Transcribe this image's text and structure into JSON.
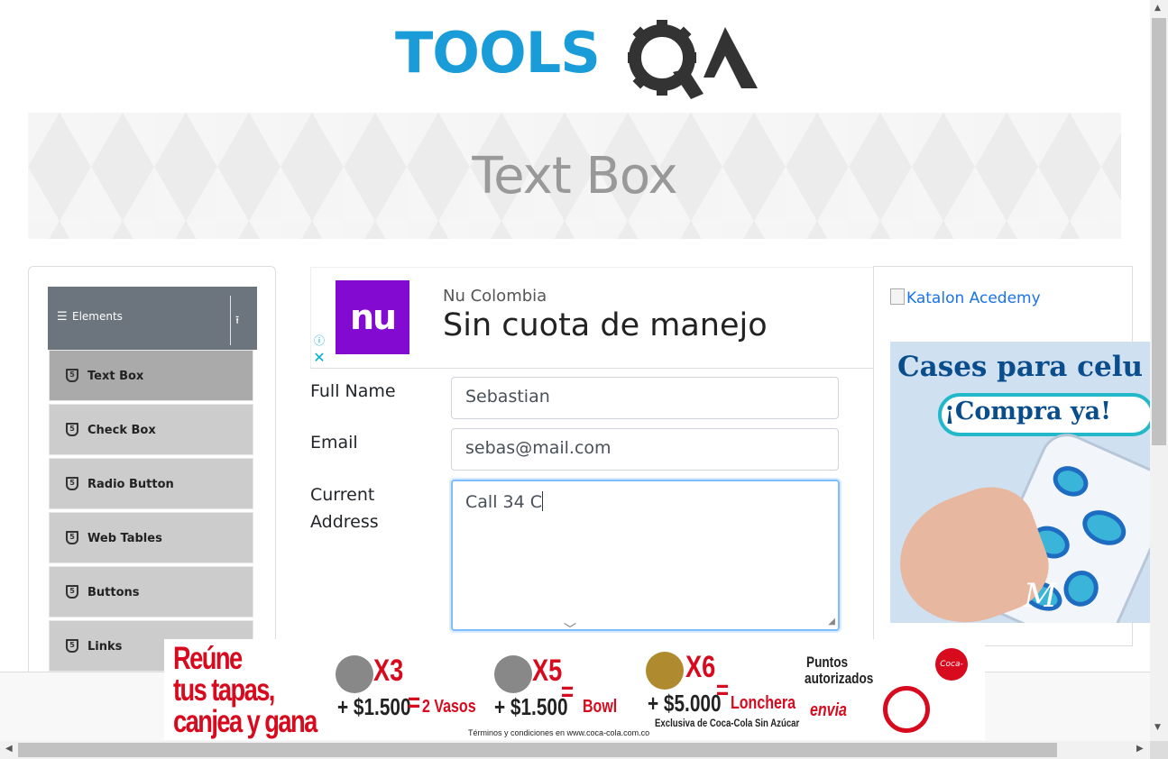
{
  "header": {
    "logo_text": "TOOLS",
    "logo_suffix": "QA"
  },
  "banner": {
    "title": "Text Box"
  },
  "sidebar": {
    "group_title": "Elements",
    "items": [
      {
        "label": "Text Box",
        "active": true
      },
      {
        "label": "Check Box"
      },
      {
        "label": "Radio Button"
      },
      {
        "label": "Web Tables"
      },
      {
        "label": "Buttons"
      },
      {
        "label": "Links"
      }
    ]
  },
  "ad_top": {
    "logo": "nu",
    "brand": "Nu Colombia",
    "headline": "Sin cuota de manejo"
  },
  "form": {
    "full_name_label": "Full Name",
    "full_name_value": "Sebastian",
    "email_label": "Email",
    "email_value": "sebas@mail.com",
    "address_label_1": "Current",
    "address_label_2": "Address",
    "address_value": "Call 34 C"
  },
  "right_ads": {
    "katalon_alt": "Katalon Acedemy",
    "case_line1": "Cases para celu",
    "case_line2": "¡Compra ya!",
    "case_mark": "M"
  },
  "bottom_ad": {
    "line1": "Reúne",
    "line2": "tus tapas,",
    "line3": "canjea y gana",
    "deal1_mult": "X3",
    "deal1_price": "+ $1.500",
    "deal1_prize": "2 Vasos",
    "deal2_mult": "X5",
    "deal2_price": "+ $1.500",
    "deal2_prize": "Bowl",
    "deal3_mult": "X6",
    "deal3_price": "+ $5.000",
    "deal3_prize": "Lonchera",
    "deal3_note": "Exclusiva de Coca-Cola Sin Azúcar",
    "points_1": "Puntos",
    "points_2": "autorizados",
    "envia": "envia",
    "terms": "Términos y condiciones en www.coca-cola.com.co",
    "brand": "Coca-Cola"
  },
  "colors": {
    "tools_blue": "#1a9cd8",
    "nu_purple": "#820ad1",
    "coke_red": "#d80a1e",
    "focus_blue": "#80bdff"
  }
}
